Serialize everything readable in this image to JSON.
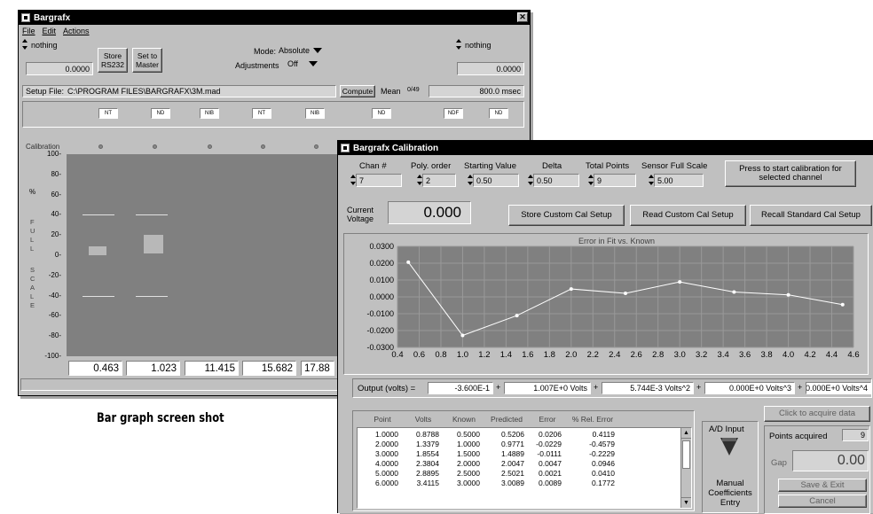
{
  "main": {
    "title": "Bargrafx",
    "menu": [
      "File",
      "Edit",
      "Actions"
    ],
    "left_selector": "nothing",
    "left_value": "0.0000",
    "store_btn": "Store RS232",
    "master_btn": "Set to Master",
    "mode_label": "Mode:",
    "mode_value": "Absolute",
    "adjust_label": "Adjustments",
    "adjust_value": "Off",
    "right_selector": "nothing",
    "right_value": "0.0000",
    "setup_label": "Setup File:",
    "setup_path": "C:\\PROGRAM FILES\\BARGRAFX\\3M.mad",
    "compute_btn": "Compute",
    "mean_label": "Mean",
    "mean_val": "0/49",
    "msec": "800.0 msec",
    "channels": [
      "NT",
      "ND",
      "NIB",
      "NT",
      "NIB",
      "ND",
      "NDF",
      "ND"
    ],
    "calib_label": "Calibration",
    "yticks": [
      "100",
      "80",
      "60",
      "40",
      "20",
      "0",
      "-20",
      "-40",
      "-60",
      "-80",
      "-100"
    ],
    "full_scale": [
      "F",
      "U",
      "L",
      "L",
      "S",
      "C",
      "A",
      "L",
      "E"
    ],
    "y_symbol": "%",
    "bottom_values": [
      "0.463",
      "1.023",
      "11.415",
      "15.682",
      "17.88"
    ],
    "bars": [
      {
        "lo": -40,
        "hi": 40,
        "fill_lo": 0,
        "fill_hi": 9
      },
      {
        "lo": -40,
        "hi": 40,
        "fill_lo": 2,
        "fill_hi": 20
      }
    ],
    "caption": "Bar graph screen shot"
  },
  "calib": {
    "title": "Bargrafx Calibration",
    "chan_label": "Chan #",
    "chan_val": "7",
    "poly_label": "Poly. order",
    "poly_val": "2",
    "start_label": "Starting Value",
    "start_val": "0.50",
    "delta_label": "Delta",
    "delta_val": "0.50",
    "total_label": "Total Points",
    "total_val": "9",
    "sensor_label": "Sensor Full Scale",
    "sensor_val": "5.00",
    "press_btn": "Press to start calibration for selected channel",
    "cv_label": "Current Voltage",
    "cv_val": "0.000",
    "store_custom": "Store Custom Cal Setup",
    "read_custom": "Read Custom Cal Setup",
    "recall_std": "Recall Standard Cal Setup",
    "output_label": "Output (volts) =",
    "coef0": "-3.600E-1",
    "coef1": "1.007E+0 Volts",
    "coef2": "5.744E-3 Volts^2",
    "coef3": "0.000E+0 Volts^3",
    "coef4": "0.000E+0 Volts^4",
    "plus": "+",
    "table_headers": [
      "Point",
      "Volts",
      "Known",
      "Predicted",
      "Error",
      "% Rel. Error"
    ],
    "table_rows": [
      [
        "1.0000",
        "0.8788",
        "0.5000",
        "0.5206",
        "0.0206",
        "0.4119"
      ],
      [
        "2.0000",
        "1.3379",
        "1.0000",
        "0.9771",
        "-0.0229",
        "-0.4579"
      ],
      [
        "3.0000",
        "1.8554",
        "1.5000",
        "1.4889",
        "-0.0111",
        "-0.2229"
      ],
      [
        "4.0000",
        "2.3804",
        "2.0000",
        "2.0047",
        "0.0047",
        "0.0946"
      ],
      [
        "5.0000",
        "2.8895",
        "2.5000",
        "2.5021",
        "0.0021",
        "0.0410"
      ],
      [
        "6.0000",
        "3.4115",
        "3.0000",
        "3.0089",
        "0.0089",
        "0.1772"
      ]
    ],
    "ad_input": "A/D Input",
    "manual": "Manual Coefficients Entry",
    "click_acq": "Click to acquire data",
    "points_acq_label": "Points acquired",
    "points_acq_val": "9",
    "gap_label": "Gap",
    "gap_val": "0.00",
    "save_exit": "Save & Exit",
    "cancel": "Cancel"
  },
  "chart_data": {
    "type": "line",
    "title": "Error in Fit vs. Known",
    "xlabel": "",
    "ylabel": "",
    "x": [
      0.5,
      1.0,
      1.5,
      2.0,
      2.5,
      3.0,
      3.5,
      4.0,
      4.5
    ],
    "values": [
      0.0206,
      -0.0229,
      -0.0111,
      0.0047,
      0.0021,
      0.0089,
      0.0029,
      0.0012,
      -0.0046
    ],
    "xlim": [
      0.4,
      4.6
    ],
    "ylim": [
      -0.03,
      0.03
    ],
    "xticks": [
      "0.4",
      "0.6",
      "0.8",
      "1.0",
      "1.2",
      "1.4",
      "1.6",
      "1.8",
      "2.0",
      "2.2",
      "2.4",
      "2.6",
      "2.8",
      "3.0",
      "3.2",
      "3.4",
      "3.6",
      "3.8",
      "4.0",
      "4.2",
      "4.4",
      "4.6"
    ],
    "yticks": [
      "0.0300",
      "0.0200",
      "0.0100",
      "0.0000",
      "-0.0100",
      "-0.0200",
      "-0.0300"
    ],
    "grid": true,
    "line_color": "#ffffff"
  }
}
